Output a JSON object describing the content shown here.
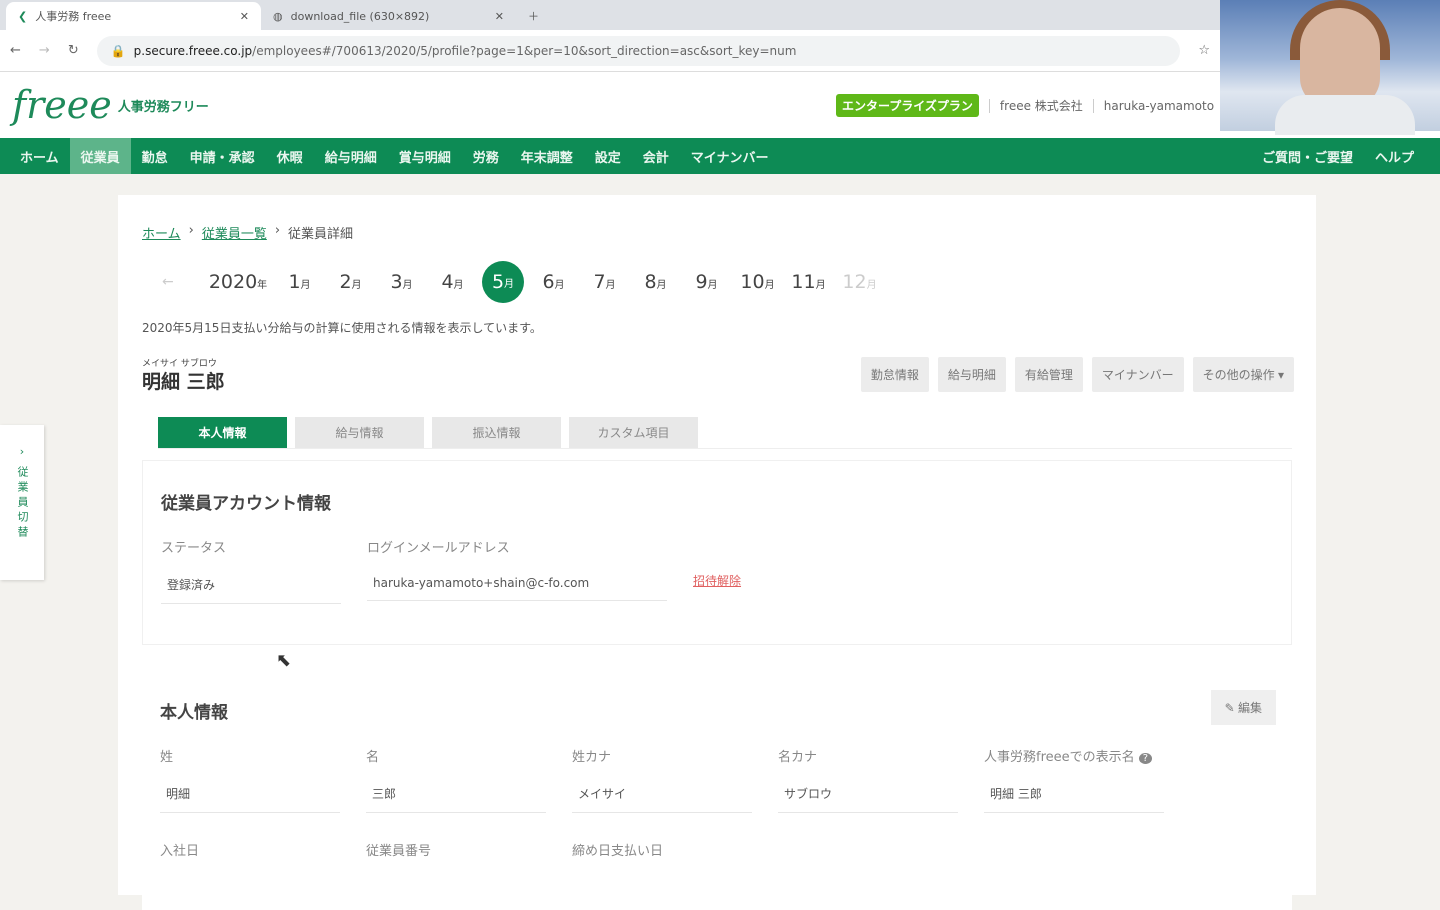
{
  "browser": {
    "tabs": [
      {
        "title": "人事労務 freee"
      },
      {
        "title": "download_file (630×892)"
      }
    ],
    "url_host": "p.secure.freee.co.jp",
    "url_path": "/employees#/700613/2020/5/profile?page=1&per=10&sort_direction=asc&sort_key=num"
  },
  "header": {
    "logo": "freee",
    "logo_sub": "人事労務フリー",
    "plan": "エンタープライズプラン",
    "company": "freee 株式会社",
    "user": "haruka-yamamoto"
  },
  "nav": {
    "items": [
      "ホーム",
      "従業員",
      "勤怠",
      "申請・承認",
      "休暇",
      "給与明細",
      "賞与明細",
      "労務",
      "年末調整",
      "設定",
      "会計",
      "マイナンバー"
    ],
    "right": [
      "ご質問・ご要望",
      "ヘルプ"
    ]
  },
  "breadcrumb": [
    "ホーム",
    "従業員一覧",
    "従業員詳細"
  ],
  "months": {
    "year": "2020",
    "year_unit": "年",
    "unit": "月",
    "items": [
      "1",
      "2",
      "3",
      "4",
      "5",
      "6",
      "7",
      "8",
      "9",
      "10",
      "11",
      "12"
    ],
    "selected": "5",
    "disabled": [
      "12"
    ]
  },
  "note": "2020年5月15日支払い分給与の計算に使用される情報を表示しています。",
  "employee": {
    "kana": "メイサイ サブロウ",
    "name": "明細 三郎"
  },
  "actions": [
    "勤怠情報",
    "給与明細",
    "有給管理",
    "マイナンバー",
    "その他の操作 ▾"
  ],
  "subtabs": [
    "本人情報",
    "給与情報",
    "振込情報",
    "カスタム項目"
  ],
  "account": {
    "title": "従業員アカウント情報",
    "status_label": "ステータス",
    "status": "登録済み",
    "email_label": "ログインメールアドレス",
    "email": "haruka-yamamoto+shain@c-fo.com",
    "link": "招待解除"
  },
  "personal": {
    "title": "本人情報",
    "edit": "編集",
    "fields": [
      {
        "label": "姓",
        "value": "明細"
      },
      {
        "label": "名",
        "value": "三郎"
      },
      {
        "label": "姓カナ",
        "value": "メイサイ"
      },
      {
        "label": "名カナ",
        "value": "サブロウ"
      },
      {
        "label": "人事労務freeeでの表示名",
        "value": "明細 三郎"
      }
    ],
    "fields2": [
      "入社日",
      "従業員番号",
      "締め日支払い日"
    ]
  },
  "side": {
    "label": "従業員切替"
  }
}
